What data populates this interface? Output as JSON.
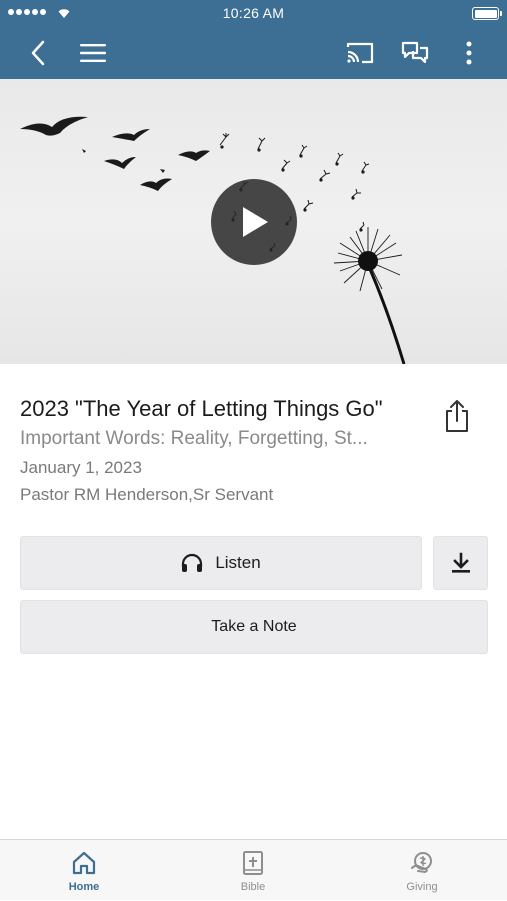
{
  "status_bar": {
    "time": "10:26 AM"
  },
  "nav": {
    "icons": [
      "back-icon",
      "menu-icon",
      "cast-icon",
      "chat-icon",
      "more-icon"
    ]
  },
  "media": {
    "title": "2023 \"The Year of Letting Things Go\"",
    "subtitle": "Important Words: Reality, Forgetting, St...",
    "date": "January 1, 2023",
    "speaker": "Pastor RM Henderson,Sr Servant"
  },
  "actions": {
    "listen_label": "Listen",
    "note_label": "Take a Note"
  },
  "tabs": [
    {
      "label": "Home",
      "icon": "home-icon",
      "active": true
    },
    {
      "label": "Bible",
      "icon": "bible-icon",
      "active": false
    },
    {
      "label": "Giving",
      "icon": "giving-icon",
      "active": false
    }
  ],
  "colors": {
    "primary": "#3d6f94",
    "button_bg": "#ececee",
    "active_tab": "#3d6f94",
    "inactive_tab": "#8e8e8e"
  }
}
